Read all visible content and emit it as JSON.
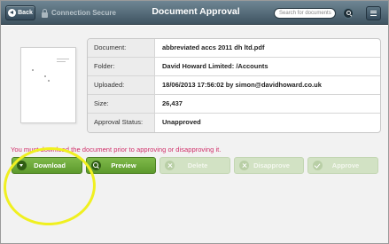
{
  "topbar": {
    "back_label": "Back",
    "secure_label": "Connection Secure",
    "title": "Document Approval",
    "search_placeholder": "Search for documents"
  },
  "details": {
    "rows": [
      {
        "label": "Document:",
        "value": "abbreviated accs 2011 dh ltd.pdf"
      },
      {
        "label": "Folder:",
        "value": "David Howard Limited: /Accounts"
      },
      {
        "label": "Uploaded:",
        "value": "18/06/2013 17:56:02 by simon@davidhoward.co.uk"
      },
      {
        "label": "Size:",
        "value": "26,437"
      },
      {
        "label": "Approval Status:",
        "value": "Unapproved"
      }
    ]
  },
  "notice": "You must download the document prior to approving or disapproving it.",
  "actions": {
    "download": "Download",
    "preview": "Preview",
    "delete": "Delete",
    "disapprove": "Disapprove",
    "approve": "Approve"
  },
  "colors": {
    "topbar": "#4f6573",
    "action_green": "#6ea93b",
    "action_disabled": "#d2e2c4",
    "notice_text": "#d0306a",
    "highlight": "#f0f020"
  },
  "icons": [
    "back-arrow-icon",
    "lock-icon",
    "search-icon",
    "menu-icon",
    "download-icon",
    "preview-icon",
    "delete-icon",
    "disapprove-icon",
    "approve-icon"
  ]
}
